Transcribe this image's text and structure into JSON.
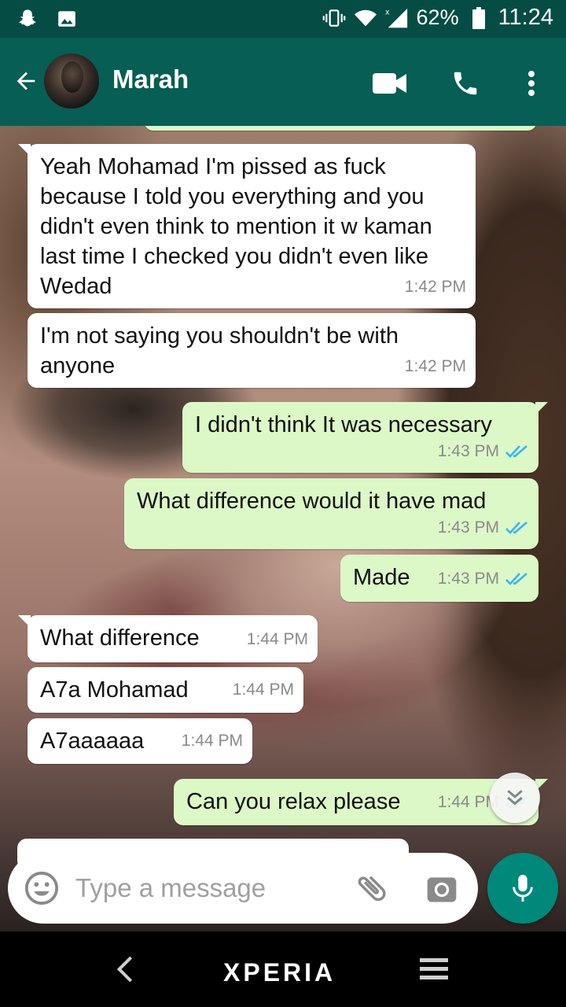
{
  "status_bar": {
    "battery": "62%",
    "time": "11:24"
  },
  "header": {
    "contact_name": "Marah"
  },
  "messages": [
    {
      "dir": "in",
      "text": "Yeah Mohamad I'm pissed as fuck because I told you everything and you didn't even think to mention it w kaman last time I checked you didn't even like Wedad",
      "time": "1:42 PM"
    },
    {
      "dir": "in",
      "text": "I'm not saying you shouldn't be with anyone",
      "time": "1:42 PM"
    },
    {
      "dir": "out",
      "text": "I didn't think It was necessary",
      "time": "1:43 PM",
      "status": "read"
    },
    {
      "dir": "out",
      "text": "What difference would it have mad",
      "time": "1:43 PM",
      "status": "read"
    },
    {
      "dir": "out",
      "text": "Made",
      "time": "1:43 PM",
      "status": "read"
    },
    {
      "dir": "in",
      "text": "What difference",
      "time": "1:44 PM"
    },
    {
      "dir": "in",
      "text": "A7a Mohamad",
      "time": "1:44 PM"
    },
    {
      "dir": "in",
      "text": "A7aaaaaa",
      "time": "1:44 PM"
    },
    {
      "dir": "out",
      "text": "Can you relax please",
      "time": "1:44 PM",
      "status": "read"
    }
  ],
  "composer": {
    "placeholder": "Type a message"
  },
  "nav_bar": {
    "brand": "XPERIA"
  },
  "colors": {
    "header": "#075e54",
    "status_bar": "#054d44",
    "outgoing_bubble": "#dcf8c6",
    "incoming_bubble": "#ffffff",
    "read_ticks": "#34b7f1",
    "mic_button": "#00897b"
  }
}
